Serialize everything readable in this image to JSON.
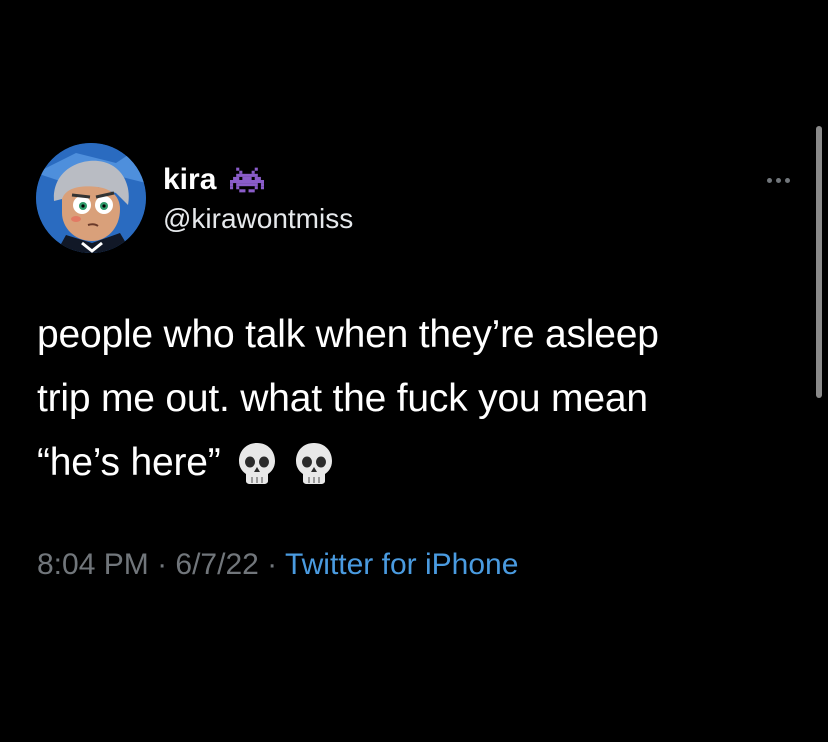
{
  "tweet": {
    "author": {
      "display_name": "kira",
      "handle": "@kirawontmiss",
      "badge_emoji": "alien-monster-icon"
    },
    "text_lines": [
      "people who talk when they’re asleep",
      "trip me out. what the fuck you mean",
      "“he’s here”"
    ],
    "emoji": [
      "skull-icon",
      "skull-icon"
    ],
    "time": "8:04 PM",
    "separator": " · ",
    "date": "6/7/22",
    "source": "Twitter for iPhone"
  },
  "colors": {
    "background": "#000000",
    "text": "#ffffff",
    "muted": "#71767b",
    "link": "#4a9be0",
    "invader": "#8a5cc9"
  }
}
